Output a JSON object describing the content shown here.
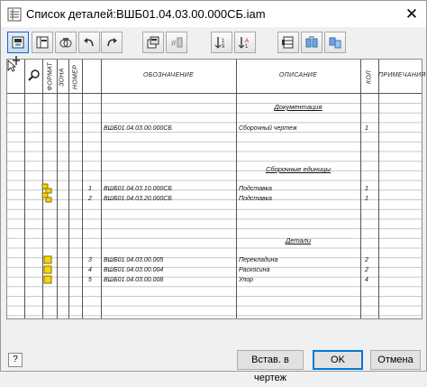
{
  "window": {
    "title": "Список деталей:ВШБ01.04.03.00.000СБ.iam",
    "close_glyph": "✕"
  },
  "toolbar": {
    "buttons": [
      {
        "icon": "bom-settings-icon"
      },
      {
        "icon": "column-chooser-icon"
      },
      {
        "icon": "filter-icon"
      },
      {
        "icon": "undo-icon"
      },
      {
        "icon": "redo-icon"
      },
      {
        "icon": "export-icon"
      },
      {
        "icon": "renumber-icon"
      },
      {
        "icon": "sort-ascending-icon"
      },
      {
        "icon": "sort-descending-icon"
      },
      {
        "icon": "grid-view-icon"
      },
      {
        "icon": "merge-rows-icon"
      },
      {
        "icon": "split-rows-icon"
      }
    ]
  },
  "table": {
    "headers": {
      "icon_col": "",
      "format": "ФОРМАТ",
      "zone": "ЗОНА",
      "number": "НОМЕР",
      "designation": "ОБОЗНАЧЕНИЕ",
      "description": "ОПИСАНИЕ",
      "qty": "КОЛ",
      "notes": "ПРИМЕЧАНИЯ"
    },
    "rows": [
      {
        "section": "Документация"
      },
      {
        "designation": "ВШБ01.04.03.00.000СБ",
        "description": "Сборочный чертеж",
        "qty": "1"
      },
      {
        "section": "Сборочные единицы"
      },
      {
        "number": "1",
        "designation": "ВШБ01.04.03.10.000СБ",
        "description": "Подставка",
        "qty": "1",
        "icon": "assembly"
      },
      {
        "number": "2",
        "designation": "ВШБ01.04.03.20.000СБ",
        "description": "Подставка",
        "qty": "1",
        "icon": "assembly"
      },
      {
        "section": "Детали"
      },
      {
        "number": "3",
        "designation": "ВШБ01.04.03.00.005",
        "description": "Перекладина",
        "qty": "2",
        "icon": "part"
      },
      {
        "number": "4",
        "designation": "ВШБ01.04.03.00.004",
        "description": "Раскосина",
        "qty": "2",
        "icon": "part"
      },
      {
        "number": "5",
        "designation": "ВШБ01.04.03.00.008",
        "description": "Упор",
        "qty": "4",
        "icon": "part"
      }
    ]
  },
  "footer": {
    "help_label": "?",
    "insert_button": "Встав. в чертеж",
    "ok_button": "OK",
    "cancel_button": "Отмена"
  },
  "colors": {
    "part_yellow": "#f5d800",
    "accent_blue": "#0078d7"
  }
}
